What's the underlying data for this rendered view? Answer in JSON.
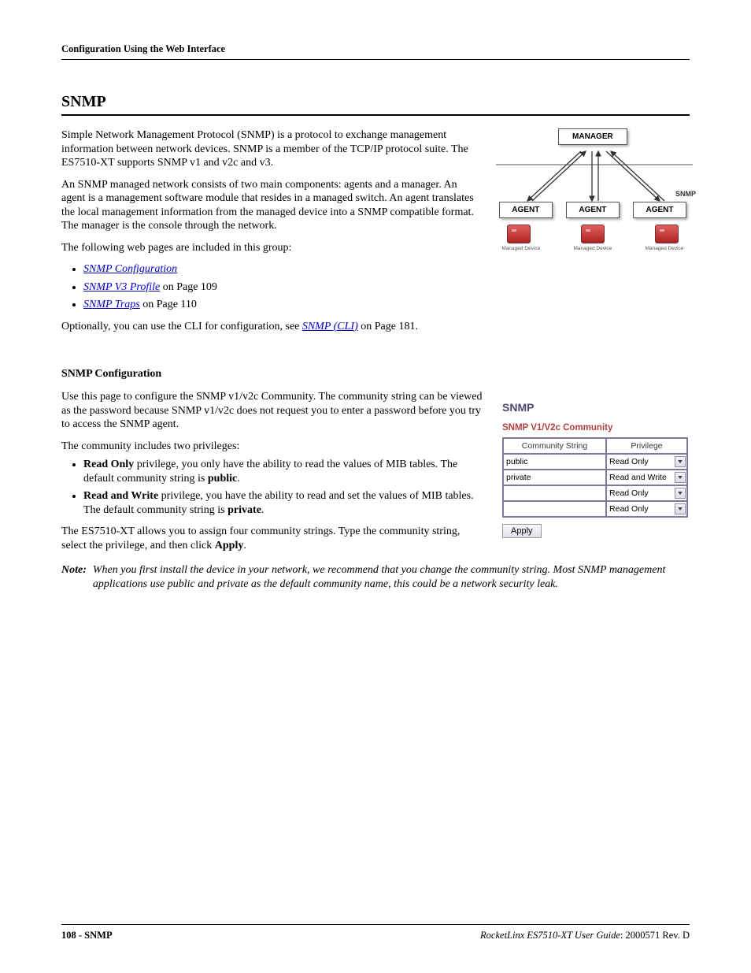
{
  "header": "Configuration Using the Web Interface",
  "section_title": "SNMP",
  "intro_p1": "Simple Network Management Protocol (SNMP) is a protocol to exchange management information between network devices. SNMP is a member of the TCP/IP protocol suite. The ES7510-XT supports SNMP v1 and v2c and v3.",
  "intro_p2": "An SNMP managed network consists of two main components: agents and a manager. An agent is a management software module that resides in a managed switch. An agent translates the local management information from the managed device into a SNMP compatible format. The manager is the console through the network.",
  "intro_p3": "The following web pages are included in this group:",
  "bullets": [
    {
      "link": "SNMP Configuration",
      "after": ""
    },
    {
      "link": "SNMP V3 Profile",
      "after": " on Page 109"
    },
    {
      "link": "SNMP Traps",
      "after": " on Page 110"
    }
  ],
  "cli_pre": "Optionally, you can use the CLI for configuration, see ",
  "cli_link": "SNMP (CLI)",
  "cli_post": " on Page 181.",
  "sub_heading": "SNMP Configuration",
  "conf_p1": "Use this page to configure the SNMP v1/v2c Community. The community string can be viewed as the password because SNMP v1/v2c does not request you to enter a password before you try to access the SNMP agent.",
  "conf_p2": "The community includes two privileges:",
  "priv_bullets": [
    {
      "bold": "Read Only",
      "rest": " privilege, you only have the ability to read the values of MIB tables. The default community string is ",
      "bold2": "public",
      "tail": "."
    },
    {
      "bold": "Read and Write",
      "rest": " privilege, you have the ability to read and set the values of MIB tables. The default community string is ",
      "bold2": "private",
      "tail": "."
    }
  ],
  "conf_p3_a": "The ES7510-XT allows you to assign four community strings. Type the community string, select the privilege, and then click ",
  "conf_p3_b": "Apply",
  "conf_p3_c": ".",
  "note_label": "Note:",
  "note_body": "When you first install the device in your network, we recommend that you change the community string. Most SNMP management applications use public and private as the default community name, this could be a network security leak.",
  "diagram": {
    "manager": "MANAGER",
    "agent": "AGENT",
    "snmp": "SNMP",
    "device_label": "Managed Device"
  },
  "panel": {
    "title": "SNMP",
    "subtitle": "SNMP V1/V2c Community",
    "col1": "Community String",
    "col2": "Privilege",
    "rows": [
      {
        "cs": "public",
        "priv": "Read Only"
      },
      {
        "cs": "private",
        "priv": "Read and Write"
      },
      {
        "cs": "",
        "priv": "Read Only"
      },
      {
        "cs": "",
        "priv": "Read Only"
      }
    ],
    "apply": "Apply"
  },
  "footer": {
    "left": "108 - SNMP",
    "right_i": "RocketLinx ES7510-XT  User Guide",
    "right_r": ": 2000571 Rev. D"
  }
}
